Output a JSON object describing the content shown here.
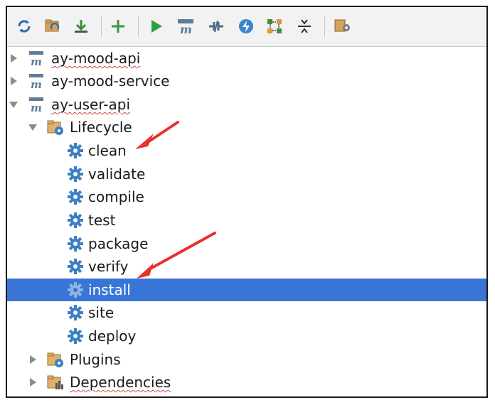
{
  "toolbar": {
    "buttons": [
      {
        "icon": "refresh-icon"
      },
      {
        "icon": "generate-sources-icon"
      },
      {
        "icon": "download-icon"
      },
      {
        "icon": "add-icon"
      },
      {
        "icon": "run-icon"
      },
      {
        "icon": "execute-maven-goal-icon"
      },
      {
        "icon": "toggle-offline-icon"
      },
      {
        "icon": "skip-tests-icon"
      },
      {
        "icon": "show-dependencies-icon"
      },
      {
        "icon": "collapse-all-icon"
      },
      {
        "icon": "settings-icon"
      }
    ]
  },
  "tree": {
    "projects": [
      {
        "label": "ay-mood-api",
        "expanded": false
      },
      {
        "label": "ay-mood-service",
        "expanded": false
      },
      {
        "label": "ay-user-api",
        "expanded": true
      }
    ],
    "lifecycle": {
      "label": "Lifecycle",
      "goals": [
        "clean",
        "validate",
        "compile",
        "test",
        "package",
        "verify",
        "install",
        "site",
        "deploy"
      ],
      "selected": "install"
    },
    "plugins": {
      "label": "Plugins"
    },
    "dependencies": {
      "label": "Dependencies"
    }
  },
  "colors": {
    "selection": "#3875d7",
    "annotation_arrow": "#e8322c",
    "gear": "#3c7fc4"
  }
}
